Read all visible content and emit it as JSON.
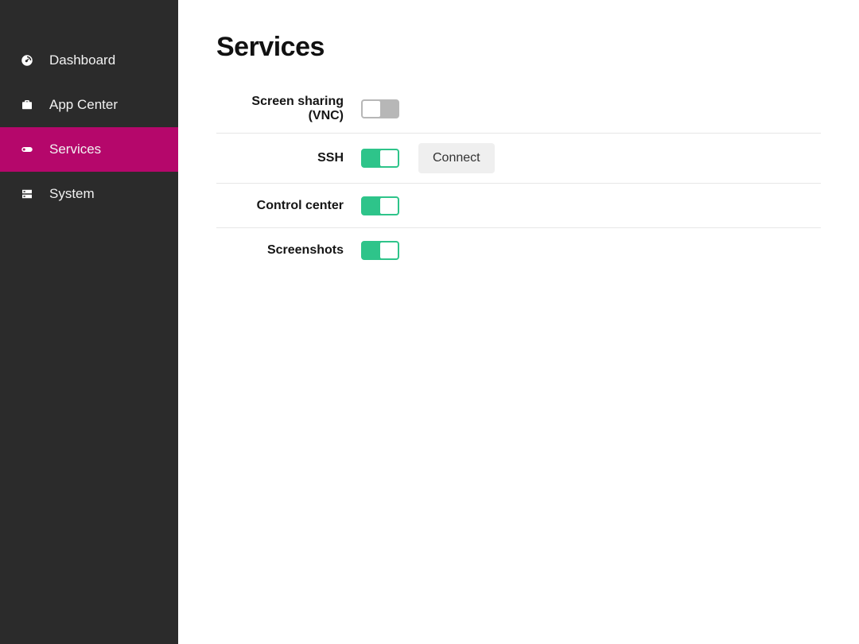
{
  "sidebar": {
    "items": [
      {
        "id": "dashboard",
        "label": "Dashboard",
        "icon": "gauge-icon",
        "active": false
      },
      {
        "id": "app-center",
        "label": "App Center",
        "icon": "briefcase-icon",
        "active": false
      },
      {
        "id": "services",
        "label": "Services",
        "icon": "toggle-icon",
        "active": true
      },
      {
        "id": "system",
        "label": "System",
        "icon": "server-icon",
        "active": false
      }
    ]
  },
  "page": {
    "title": "Services"
  },
  "services": [
    {
      "id": "vnc",
      "label": "Screen sharing (VNC)",
      "enabled": false,
      "action": null
    },
    {
      "id": "ssh",
      "label": "SSH",
      "enabled": true,
      "action": "Connect"
    },
    {
      "id": "control-center",
      "label": "Control center",
      "enabled": true,
      "action": null
    },
    {
      "id": "screenshots",
      "label": "Screenshots",
      "enabled": true,
      "action": null
    }
  ],
  "colors": {
    "accent": "#b5076b",
    "toggle_on": "#2ec48a",
    "toggle_off": "#b7b7b7",
    "sidebar_bg": "#2b2b2b"
  }
}
